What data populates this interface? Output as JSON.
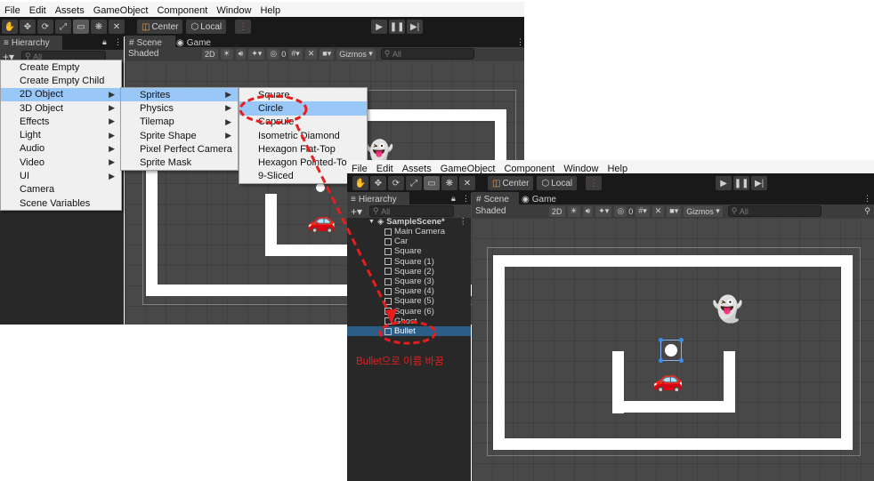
{
  "menu_bar": [
    "File",
    "Edit",
    "Assets",
    "GameObject",
    "Component",
    "Window",
    "Help"
  ],
  "toolbar": {
    "center": "Center",
    "local": "Local"
  },
  "hierarchy": {
    "tab": "Hierarchy",
    "add": "+▾",
    "search": "All"
  },
  "scene_tabs": {
    "scene": "Scene",
    "game": "Game"
  },
  "scene_bar": {
    "shaded": "Shaded",
    "mode_2d": "2D",
    "layers_count": "0",
    "gizmos": "Gizmos",
    "search": "All"
  },
  "context_menu": {
    "items": [
      "Create Empty",
      "Create Empty Child",
      "2D Object",
      "3D Object",
      "Effects",
      "Light",
      "Audio",
      "Video",
      "UI",
      "Camera",
      "Scene Variables"
    ],
    "submenu_2d": [
      "Sprites",
      "Physics",
      "Tilemap",
      "Sprite Shape",
      "Pixel Perfect Camera",
      "Sprite Mask"
    ],
    "submenu_sprites": [
      "Square",
      "Circle",
      "Capsule",
      "Isometric Diamond",
      "Hexagon Flat-Top",
      "Hexagon Pointed-Top",
      "9-Sliced"
    ]
  },
  "hierarchy_tree": {
    "scene": "SampleScene*",
    "items": [
      "Main Camera",
      "Car",
      "Square",
      "Square (1)",
      "Square (2)",
      "Square (3)",
      "Square (4)",
      "Square (5)",
      "Square (6)",
      "Ghost",
      "Bullet"
    ]
  },
  "annotation": "Bullet으로 이름 바꿈",
  "colors": {
    "panel": "#282828",
    "scene": "#484848",
    "selection": "#2c5d87",
    "menu_highlight": "#99c8f8",
    "annotation_red": "#e81e1e"
  }
}
